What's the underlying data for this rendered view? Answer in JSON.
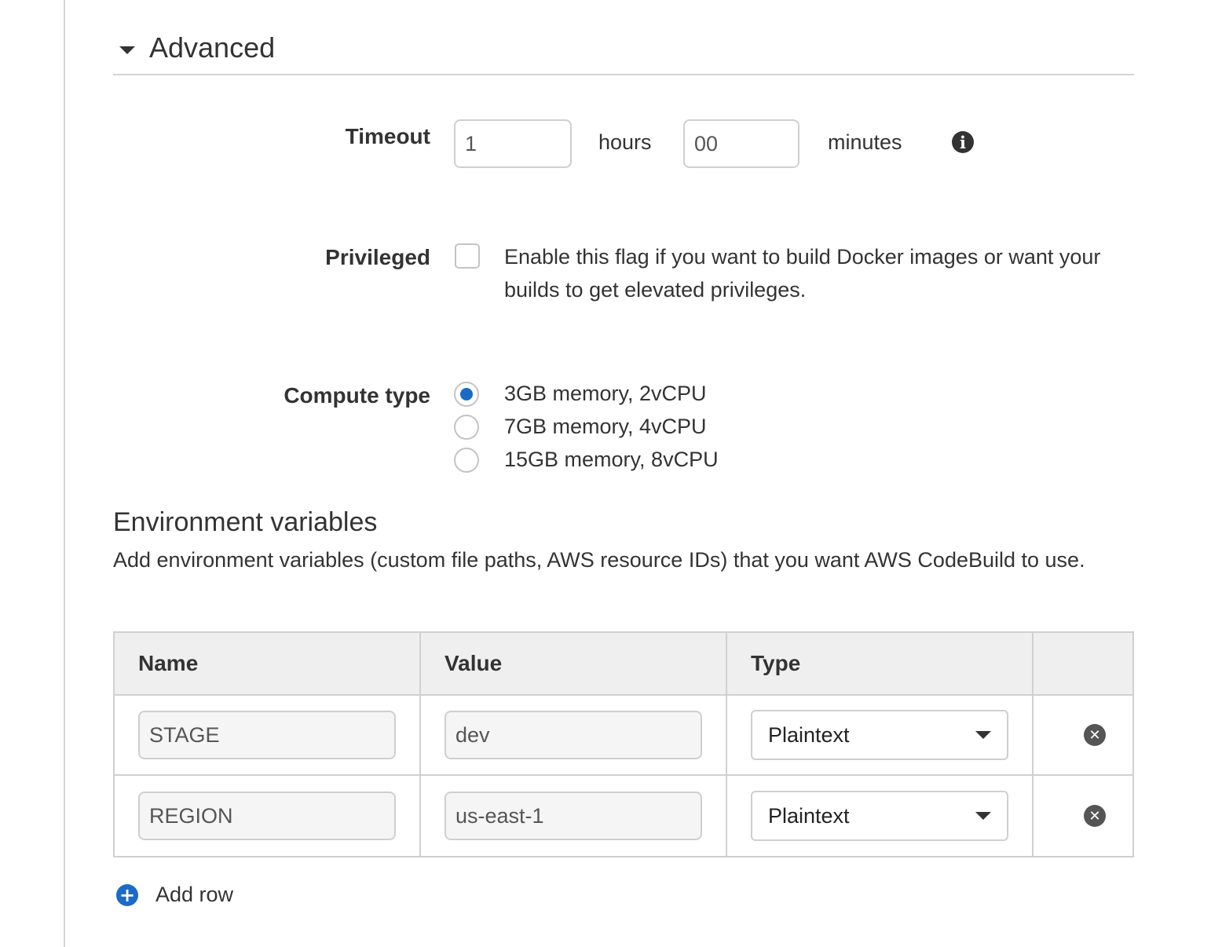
{
  "advanced": {
    "title": "Advanced",
    "timeout": {
      "label": "Timeout",
      "hours_value": "1",
      "hours_unit": "hours",
      "minutes_value": "00",
      "minutes_unit": "minutes",
      "info_icon": "info-icon"
    },
    "privileged": {
      "label": "Privileged",
      "checked": false,
      "description": "Enable this flag if you want to build Docker images or want your builds to get elevated privileges."
    },
    "compute_type": {
      "label": "Compute type",
      "options": [
        {
          "label": "3GB memory, 2vCPU",
          "selected": true
        },
        {
          "label": "7GB memory, 4vCPU",
          "selected": false
        },
        {
          "label": "15GB memory, 8vCPU",
          "selected": false
        }
      ]
    }
  },
  "env_vars": {
    "title": "Environment variables",
    "description": "Add environment variables (custom file paths, AWS resource IDs) that you want AWS CodeBuild to use.",
    "columns": [
      "Name",
      "Value",
      "Type"
    ],
    "rows": [
      {
        "name": "STAGE",
        "value": "dev",
        "type": "Plaintext"
      },
      {
        "name": "REGION",
        "value": "us-east-1",
        "type": "Plaintext"
      }
    ],
    "add_row_label": "Add row"
  },
  "colors": {
    "accent": "#1b6ac6",
    "border": "#d0d0d0",
    "header_bg": "#efefef"
  }
}
